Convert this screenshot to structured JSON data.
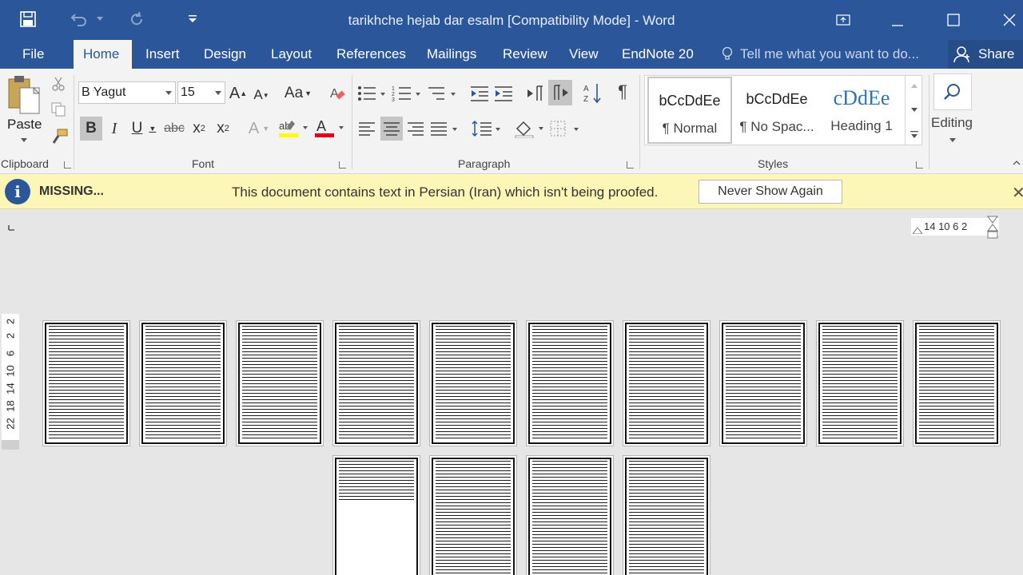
{
  "window": {
    "title": "tarikhche hejab dar esalm [Compatibility Mode] - Word"
  },
  "tabs": [
    "File",
    "Home",
    "Insert",
    "Design",
    "Layout",
    "References",
    "Mailings",
    "Review",
    "View",
    "EndNote 20"
  ],
  "active_tab": "Home",
  "tell_me": "Tell me what you want to do...",
  "share_label": "Share",
  "ribbon": {
    "clipboard": {
      "label": "Clipboard",
      "paste_label": "Paste"
    },
    "font": {
      "label": "Font",
      "font_name": "B Yagut",
      "font_size": "15"
    },
    "paragraph": {
      "label": "Paragraph"
    },
    "styles": {
      "label": "Styles",
      "items": [
        {
          "sample": "bCcDdEe",
          "name": "¶ Normal"
        },
        {
          "sample": "bCcDdEe",
          "name": "¶ No Spac..."
        },
        {
          "sample": "cDdEe",
          "name": "Heading 1"
        }
      ]
    },
    "editing": {
      "label": "Editing"
    }
  },
  "message_bar": {
    "title": "MISSING...",
    "text": "This document contains text in Persian (Iran) which isn't being proofed.",
    "button": "Never Show Again"
  },
  "ruler": {
    "horizontal": "14  10   6    2",
    "vertical": [
      "2",
      "2",
      "6",
      "10",
      "14",
      "18",
      "22"
    ]
  },
  "document": {
    "page_count_visible": 14
  },
  "colors": {
    "accent": "#2b579a",
    "message_bar": "#fcf7b6",
    "highlight": "#ffff00",
    "font_color": "#e0001b"
  }
}
